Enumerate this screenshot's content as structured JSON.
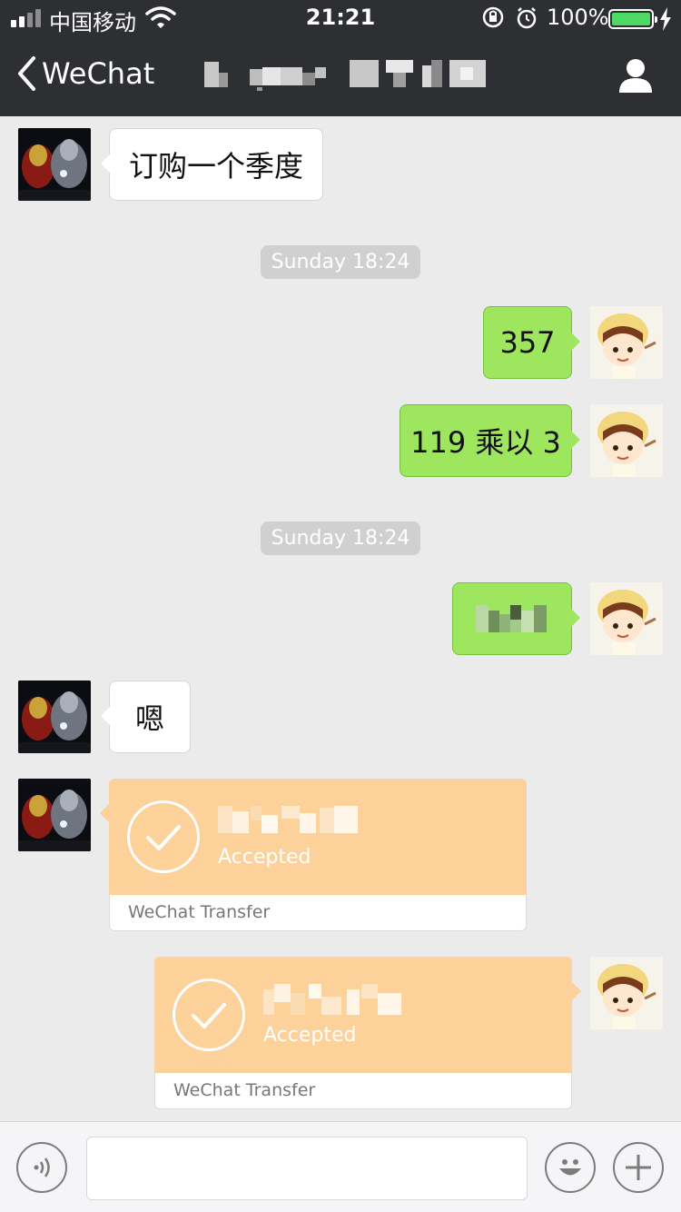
{
  "status_bar": {
    "carrier": "中国移动",
    "time": "21:21",
    "battery": "100%"
  },
  "nav": {
    "back_label": "WeChat"
  },
  "messages": {
    "m1_text": "订购一个季度",
    "ts1": "Sunday 18:24",
    "m2_text": "357",
    "m3_text": "119 乘以 3",
    "ts2": "Sunday 18:24",
    "m5_text": "嗯",
    "transfer1_status": "Accepted",
    "transfer1_label": "WeChat Transfer",
    "transfer2_status": "Accepted",
    "transfer2_label": "WeChat Transfer"
  },
  "colors": {
    "header_bg": "#2e2f33",
    "chat_bg": "#ebebeb",
    "outgoing_bubble": "#9fe65f",
    "transfer_card": "#fcd29a"
  },
  "icons": [
    "signal-icon",
    "wifi-icon",
    "lock-rotation-icon",
    "alarm-icon",
    "battery-icon",
    "charging-icon",
    "back-chevron-icon",
    "profile-icon",
    "voice-icon",
    "emoji-icon",
    "plus-icon",
    "checkmark-icon"
  ]
}
